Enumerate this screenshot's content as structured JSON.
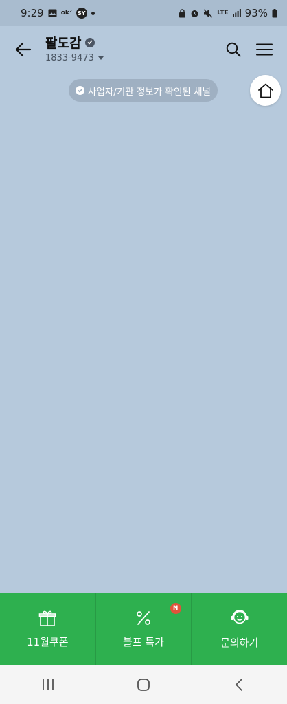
{
  "status_bar": {
    "time": "9:29",
    "ok_badge": "ok²",
    "sy_badge": "SY",
    "lte": "LTE",
    "battery": "93%"
  },
  "header": {
    "title": "팔도감",
    "phone": "1833-9473"
  },
  "verified_notice": {
    "prefix": "사업자/기관 정보가 ",
    "link": "확인된 채널"
  },
  "bottom_menu": {
    "items": [
      {
        "label": "11월쿠폰",
        "icon": "gift-icon"
      },
      {
        "label": "블프 특가",
        "icon": "percent-icon",
        "badge": "N"
      },
      {
        "label": "문의하기",
        "icon": "headset-smile-icon"
      }
    ]
  },
  "colors": {
    "background": "#b6c9dc",
    "menu_green": "#2eb04f",
    "badge_red": "#e0533b"
  }
}
